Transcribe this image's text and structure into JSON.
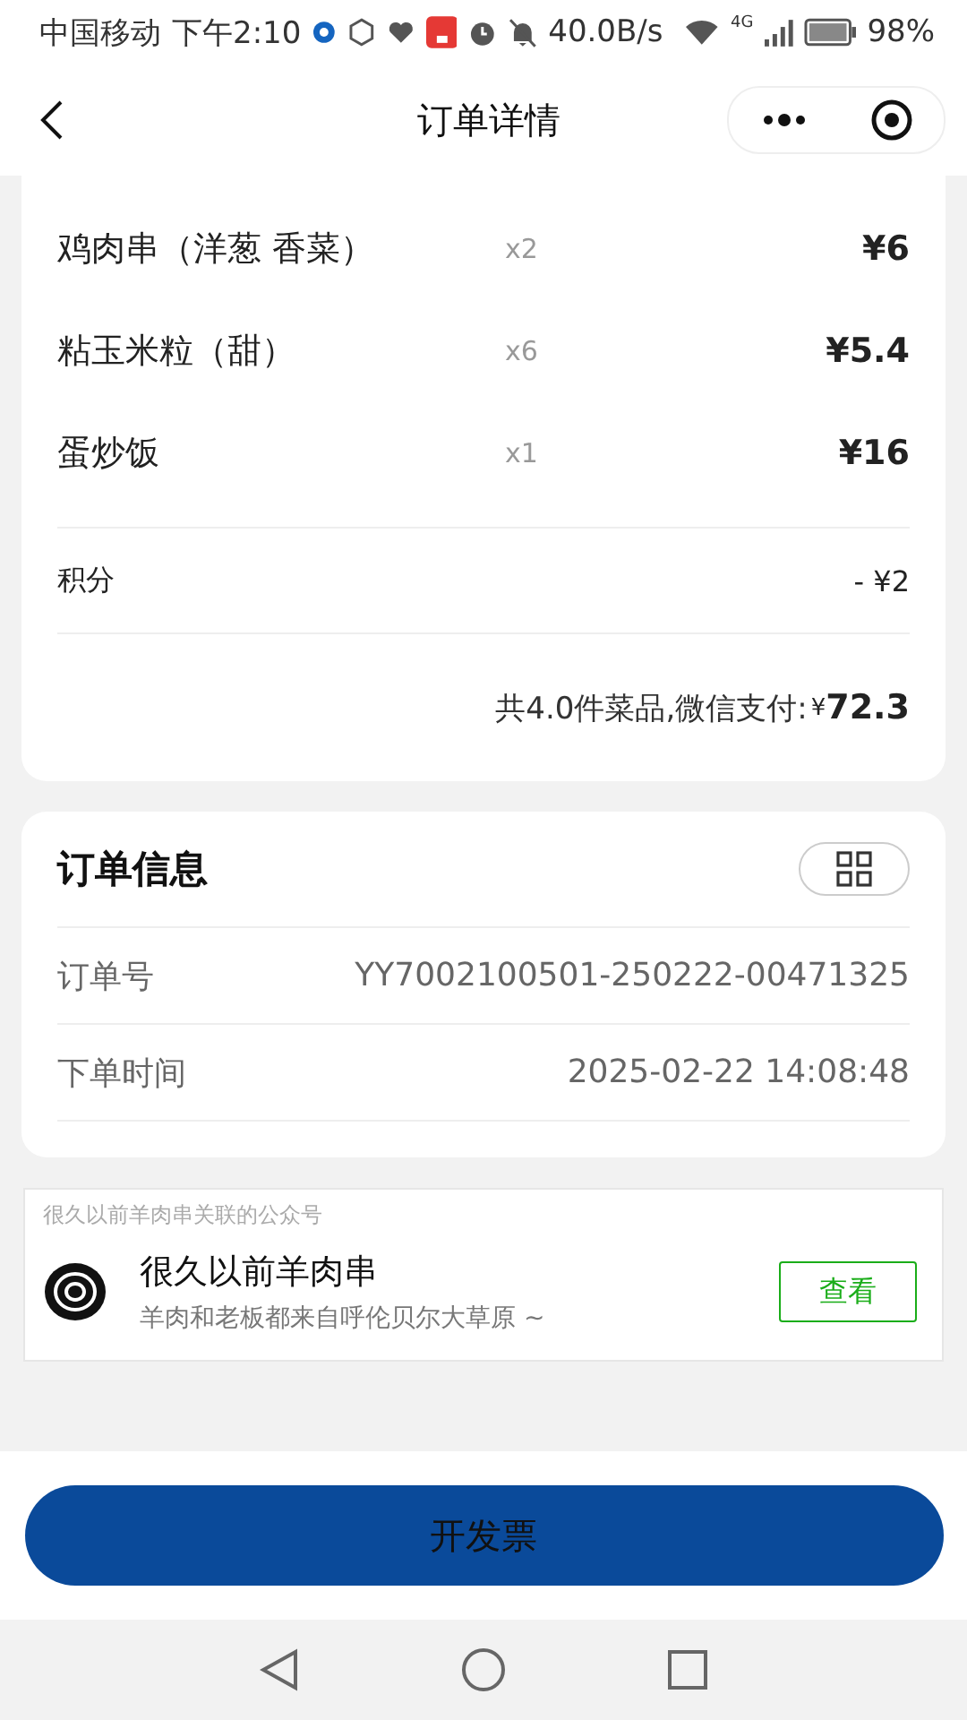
{
  "status_bar": {
    "carrier": "中国移动",
    "time": "下午2:10",
    "speed": "40.0B/s",
    "network": "4G",
    "battery": "98%"
  },
  "nav": {
    "title": "订单详情"
  },
  "items": [
    {
      "name": "鸡肉串（洋葱 香菜）",
      "qty": "x2",
      "price": "¥6"
    },
    {
      "name": "粘玉米粒（甜）",
      "qty": "x6",
      "price": "¥5.4"
    },
    {
      "name": "蛋炒饭",
      "qty": "x1",
      "price": "¥16"
    }
  ],
  "discount": {
    "label": "积分",
    "value": "- ¥2"
  },
  "summary": {
    "text": "共4.0件菜品,微信支付:",
    "currency": "¥",
    "amount": "72.3"
  },
  "order_info": {
    "title": "订单信息",
    "rows": [
      {
        "label": "订单号",
        "value": "YY7002100501-250222-00471325"
      },
      {
        "label": "下单时间",
        "value": "2025-02-22 14:08:48"
      }
    ]
  },
  "official_account": {
    "caption": "很久以前羊肉串关联的公众号",
    "name": "很久以前羊肉串",
    "description": "羊肉和老板都来自呼伦贝尔大草原 ~",
    "button": "查看"
  },
  "invoice_button": "开发票"
}
